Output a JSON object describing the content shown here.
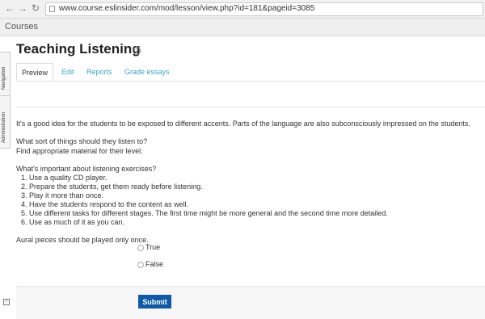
{
  "browser": {
    "back_icon": "back-arrow-icon",
    "forward_icon": "forward-arrow-icon",
    "refresh_icon": "refresh-icon",
    "url": "www.course.eslinsider.com/mod/lesson/view.php?id=181&pageid=3085"
  },
  "header": {
    "courses_link": "Courses"
  },
  "sidebar": {
    "tabs": [
      "Navigation",
      "Administration"
    ]
  },
  "lesson": {
    "title": "Teaching Listening",
    "help_icon": "help-icon",
    "tabs": [
      "Preview",
      "Edit",
      "Reports",
      "Grade essays"
    ],
    "paragraphs": [
      "It's a good idea for the students to be exposed to different accents. Parts of the language are also subconsciously impressed on the students.",
      "What sort of things should they listen to?",
      "Find appropriate material for their level.",
      "What's important about listening exercises?"
    ],
    "list": [
      "Use a quality CD player.",
      "Prepare the students, get them ready before listening.",
      "Play it more than once.",
      "Have the students respond to the content as well.",
      "Use different tasks for different stages. The first time might be more general and the second time more detailed.",
      "Use as much of it as you can."
    ],
    "question": "Aural pieces should be played only once.",
    "options": [
      "True",
      "False"
    ],
    "submit_label": "Submit"
  }
}
